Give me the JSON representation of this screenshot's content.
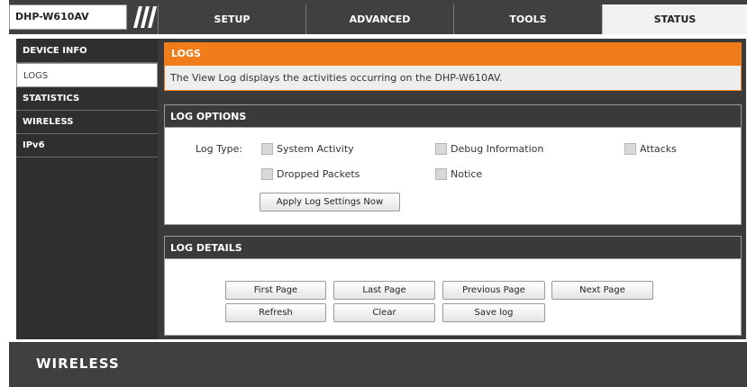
{
  "header": {
    "model": "DHP-W610AV",
    "tabs": [
      {
        "label": "SETUP"
      },
      {
        "label": "ADVANCED"
      },
      {
        "label": "TOOLS"
      },
      {
        "label": "STATUS"
      }
    ],
    "active_tab": "STATUS"
  },
  "sidebar": {
    "items": [
      {
        "label": "DEVICE INFO"
      },
      {
        "label": "LOGS"
      },
      {
        "label": "STATISTICS"
      },
      {
        "label": "WIRELESS"
      },
      {
        "label": "IPv6"
      }
    ],
    "active_item": "LOGS"
  },
  "logs": {
    "title": "LOGS",
    "description": "The View Log displays the activities occurring on the DHP-W610AV."
  },
  "log_options": {
    "title": "LOG OPTIONS",
    "log_type_label": "Log Type:",
    "checkboxes": [
      {
        "label": "System Activity",
        "checked": false
      },
      {
        "label": "Debug Information",
        "checked": false
      },
      {
        "label": "Attacks",
        "checked": false
      },
      {
        "label": "Dropped Packets",
        "checked": false
      },
      {
        "label": "Notice",
        "checked": false
      }
    ],
    "apply_button": "Apply Log Settings Now"
  },
  "log_details": {
    "title": "LOG DETAILS",
    "buttons": {
      "first_page": "First Page",
      "last_page": "Last Page",
      "previous_page": "Previous Page",
      "next_page": "Next Page",
      "refresh": "Refresh",
      "clear": "Clear",
      "save_log": "Save log"
    }
  },
  "footer": {
    "brand": "WIRELESS"
  },
  "colors": {
    "accent_orange": "#f07d1a",
    "dark_bar": "#404040",
    "sidebar_bg": "#2f2f2f"
  }
}
